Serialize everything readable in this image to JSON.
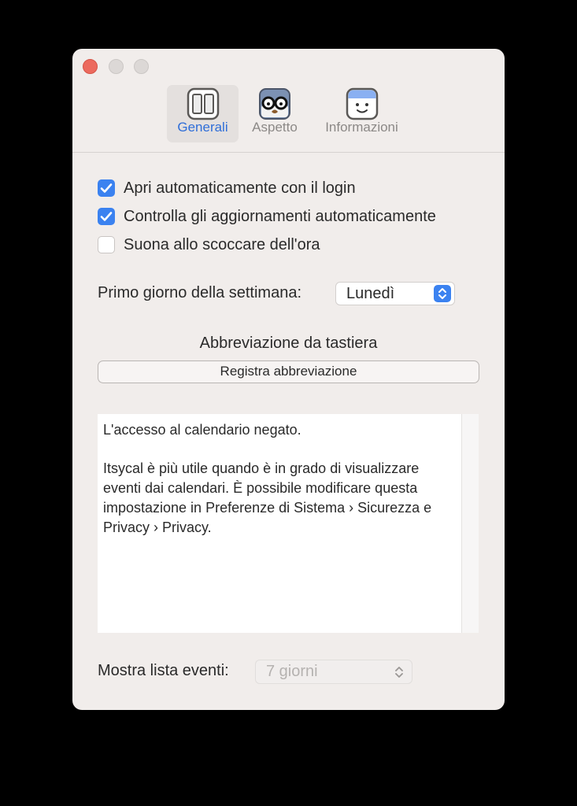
{
  "tabs": {
    "general": "Generali",
    "aspect": "Aspetto",
    "info": "Informazioni"
  },
  "options": {
    "auto_open": {
      "label": "Apri automaticamente con il login",
      "checked": true
    },
    "auto_update": {
      "label": "Controlla gli aggiornamenti automaticamente",
      "checked": true
    },
    "chime": {
      "label": "Suona allo scoccare dell'ora",
      "checked": false
    }
  },
  "first_day": {
    "label": "Primo giorno della settimana:",
    "value": "Lunedì"
  },
  "shortcut": {
    "label": "Abbreviazione da tastiera",
    "button": "Registra abbreviazione"
  },
  "calendar_notice": {
    "line1": "L'accesso al calendario negato.",
    "line2": "Itsycal è più utile quando è in grado di visualizzare eventi dai calendari. È possibile modificare questa impostazione in Preferenze di Sistema › Sicurezza e Privacy › Privacy."
  },
  "events": {
    "label": "Mostra lista eventi:",
    "value": "7 giorni"
  },
  "colors": {
    "accent": "#3b82f0",
    "selected_tab_text": "#2f6ed8",
    "close_button": "#ec6a5e"
  },
  "icons": [
    "layout-columns-icon",
    "disguise-glasses-icon",
    "smiley-calendar-icon",
    "checkmark-icon",
    "up-down-chevron-icon"
  ]
}
